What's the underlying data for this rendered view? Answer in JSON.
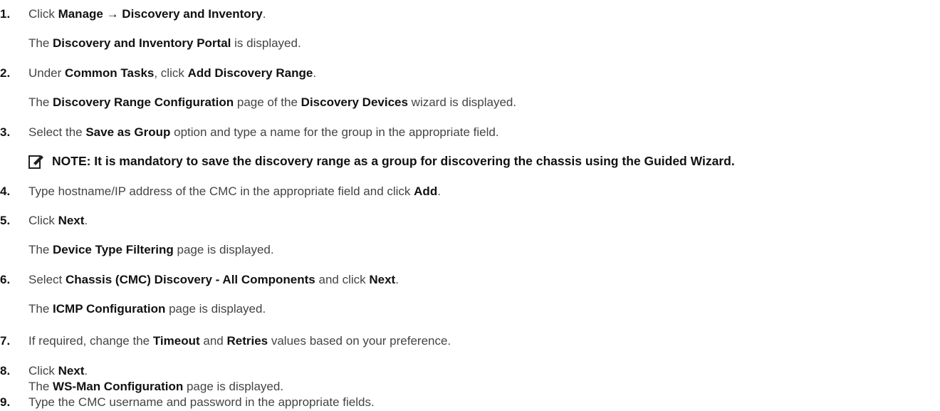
{
  "steps": [
    {
      "num": "1.",
      "parts": [
        "Click ",
        "Manage → Discovery and Inventory",
        "."
      ],
      "sub": [
        "The ",
        "Discovery and Inventory Portal",
        " is displayed."
      ]
    },
    {
      "num": "2.",
      "parts": [
        "Under ",
        "Common Tasks",
        ", click ",
        "Add Discovery Range",
        "."
      ],
      "sub": [
        "The ",
        "Discovery Range Configuration",
        " page of the ",
        "Discovery Devices",
        " wizard is displayed."
      ]
    },
    {
      "num": "3.",
      "parts": [
        "Select the ",
        "Save as Group",
        " option and type a name for the group in the appropriate field."
      ]
    },
    {
      "num": "4.",
      "parts": [
        "Type hostname/IP address of the CMC in the appropriate field and click ",
        "Add",
        "."
      ]
    },
    {
      "num": "5.",
      "parts": [
        "Click ",
        "Next",
        "."
      ],
      "sub": [
        "The ",
        "Device Type Filtering",
        " page is displayed."
      ]
    },
    {
      "num": "6.",
      "parts": [
        "Select ",
        "Chassis (CMC) Discovery - All Components",
        " and click ",
        "Next",
        "."
      ],
      "sub": [
        "The ",
        "ICMP Configuration",
        " page is displayed."
      ]
    },
    {
      "num": "7.",
      "parts": [
        "If required, change the ",
        "Timeout",
        " and ",
        "Retries",
        " values based on your preference."
      ]
    },
    {
      "num": "8.",
      "parts": [
        "Click ",
        "Next",
        "."
      ],
      "sub": [
        "The ",
        "WS-Man Configuration",
        " page is displayed."
      ]
    },
    {
      "num": "9.",
      "parts": [
        "Type the CMC username and password in the appropriate fields."
      ]
    }
  ],
  "note": {
    "icon": "pencil-note-icon",
    "text": "NOTE: It is mandatory to save the discovery range as a group for discovering the chassis using the Guided Wizard."
  }
}
